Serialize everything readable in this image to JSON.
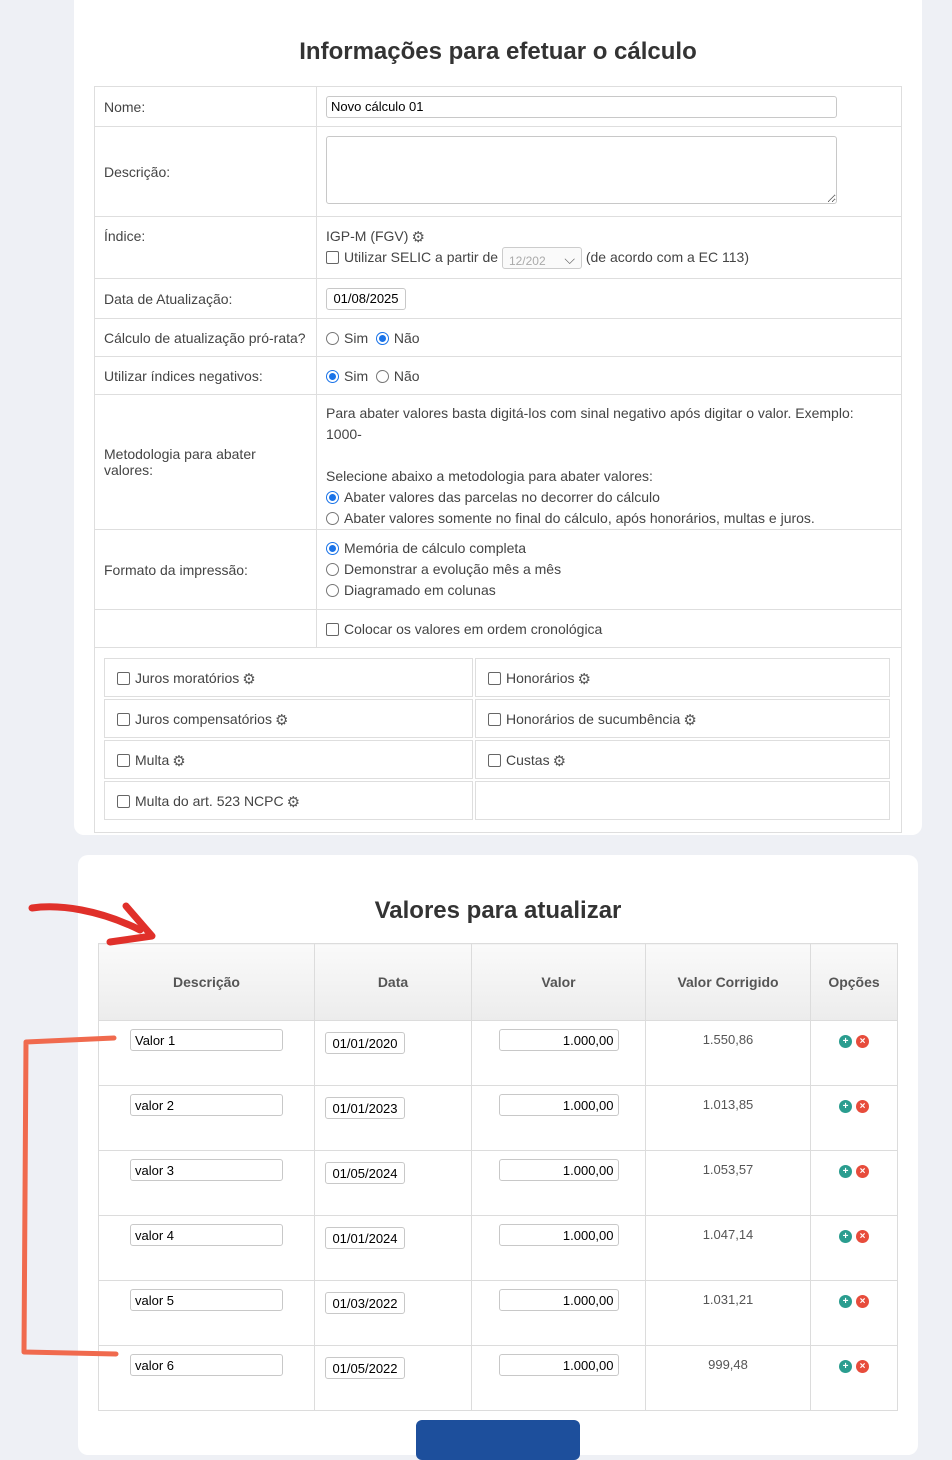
{
  "form": {
    "title": "Informações para efetuar o cálculo",
    "nome_label": "Nome:",
    "nome_value": "Novo cálculo 01",
    "descricao_label": "Descrição:",
    "indice_label": "Índice:",
    "indice_value": "IGP-M (FGV)",
    "selic_label": "Utilizar SELIC a partir de",
    "selic_select_value": "12/202",
    "selic_suffix": "(de acordo com a EC 113)",
    "data_label": "Data de Atualização:",
    "data_value": "01/08/2025",
    "prorata_label": "Cálculo de atualização pró-rata?",
    "sim": "Sim",
    "nao": "Não",
    "negativos_label": "Utilizar índices negativos:",
    "metodologia_label": "Metodologia para abater valores:",
    "metodologia_info": "Para abater valores basta digitá-los com sinal negativo após digitar o valor. Exemplo: 1000-",
    "metodologia_select": "Selecione abaixo a metodologia para abater valores:",
    "metodologia_opt1": "Abater valores das parcelas no decorrer do cálculo",
    "metodologia_opt2": "Abater valores somente no final do cálculo, após honorários, multas e juros.",
    "formato_label": "Formato da impressão:",
    "formato_opt1": "Memória de cálculo completa",
    "formato_opt2": "Demonstrar a evolução mês a mês",
    "formato_opt3": "Diagramado em colunas",
    "cronologica_label": "Colocar os valores em ordem cronológica",
    "options": {
      "juros_moratorios": "Juros moratórios",
      "honorarios": "Honorários",
      "juros_compensatorios": "Juros compensatórios",
      "honorarios_sucumbencia": "Honorários de sucumbência",
      "multa": "Multa",
      "custas": "Custas",
      "multa_523": "Multa do art. 523 NCPC"
    }
  },
  "values": {
    "title": "Valores para atualizar",
    "headers": {
      "descricao": "Descrição",
      "data": "Data",
      "valor": "Valor",
      "valor_corrigido": "Valor Corrigido",
      "opcoes": "Opções"
    },
    "rows": [
      {
        "descricao": "Valor 1",
        "data": "01/01/2020",
        "valor": "1.000,00",
        "corrigido": "1.550,86"
      },
      {
        "descricao": "valor 2",
        "data": "01/01/2023",
        "valor": "1.000,00",
        "corrigido": "1.013,85"
      },
      {
        "descricao": "valor 3",
        "data": "01/05/2024",
        "valor": "1.000,00",
        "corrigido": "1.053,57"
      },
      {
        "descricao": "valor 4",
        "data": "01/01/2024",
        "valor": "1.000,00",
        "corrigido": "1.047,14"
      },
      {
        "descricao": "valor 5",
        "data": "01/03/2022",
        "valor": "1.000,00",
        "corrigido": "1.031,21"
      },
      {
        "descricao": "valor 6",
        "data": "01/05/2022",
        "valor": "1.000,00",
        "corrigido": "999,48"
      }
    ]
  },
  "colors": {
    "accent": "#1a73e8",
    "add_icon": "#2a9d8f",
    "delete_icon": "#e74c3c",
    "annotation": "#e0302a",
    "submit_button": "#1d4f9c"
  }
}
